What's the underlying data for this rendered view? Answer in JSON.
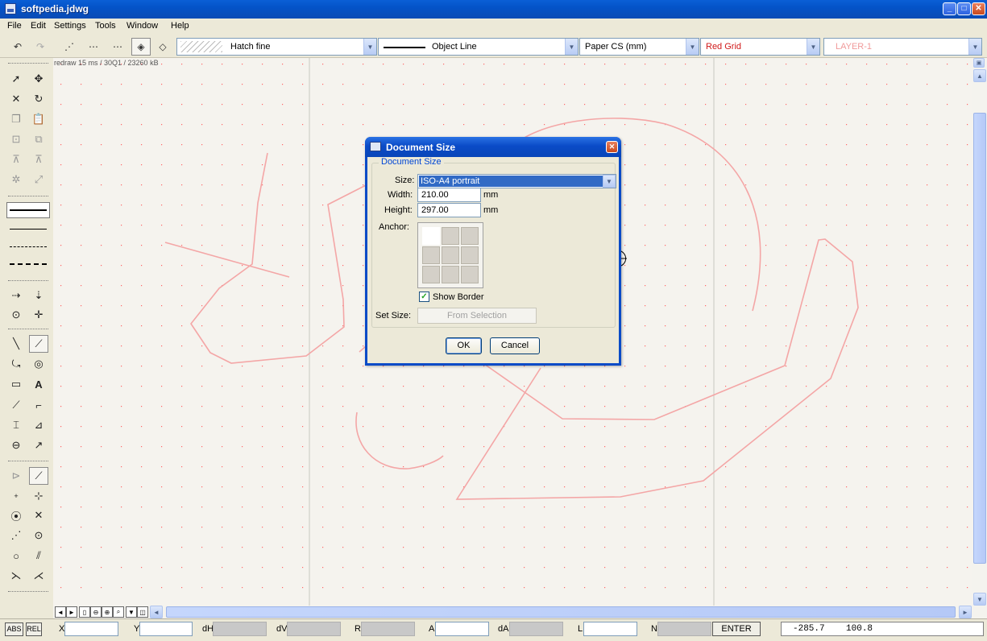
{
  "window": {
    "title": "softpedia.jdwg"
  },
  "menu": [
    "File",
    "Edit",
    "Settings",
    "Tools",
    "Window",
    "Help"
  ],
  "toolbar": {
    "hatch": "Hatch fine",
    "linetype": "Object Line",
    "coordsys": "Paper CS (mm)",
    "grid": "Red Grid",
    "layer": "LAYER-1"
  },
  "canvas": {
    "status_overlay": "redraw 15 ms / 30Q1 / 23260 kB",
    "grid_color": "#ff6666",
    "geometry_color": "#f4a6a6"
  },
  "dialog": {
    "title": "Document Size",
    "group_label": "Document Size",
    "size_label": "Size:",
    "size_value": "ISO-A4 portrait",
    "width_label": "Width:",
    "width_value": "210.00",
    "height_label": "Height:",
    "height_value": "297.00",
    "unit": "mm",
    "anchor_label": "Anchor:",
    "anchor_selected": "top-left",
    "show_border_label": "Show Border",
    "show_border_checked": true,
    "set_size_label": "Set Size:",
    "from_selection": "From Selection",
    "ok": "OK",
    "cancel": "Cancel"
  },
  "statusbar": {
    "abs": "ABS",
    "rel": "REL",
    "labels": {
      "x": "X",
      "y": "Y",
      "dh": "dH",
      "dv": "dV",
      "r": "R",
      "a": "A",
      "da": "dA",
      "l": "L",
      "n": "N"
    },
    "enter": "ENTER",
    "coords": "-285.7    100.8"
  }
}
